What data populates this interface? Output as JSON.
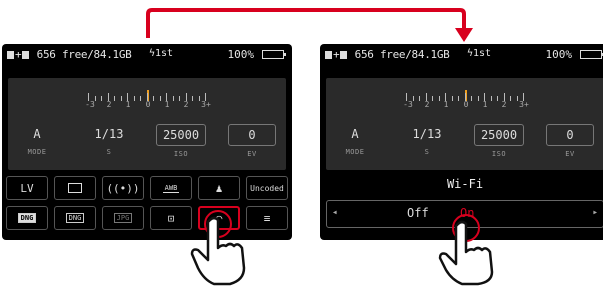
{
  "status": {
    "storage_text": "656 free/84.1GB",
    "flash_text": "ϟ1st",
    "battery_percent": "100%"
  },
  "meter": {
    "labels": [
      "-3",
      "2",
      "1",
      "0",
      "1",
      "2",
      "3+"
    ]
  },
  "exposure": {
    "mode": {
      "value": "A",
      "label": "MODE"
    },
    "shutter": {
      "value": "1/13",
      "label": "S"
    },
    "iso": {
      "value": "25000",
      "label": "ISO"
    },
    "ev": {
      "value": "0",
      "label": "EV"
    }
  },
  "left_menu": {
    "row1": [
      "LV",
      "",
      "",
      "AWB",
      "",
      "Uncoded"
    ],
    "row2": [
      "DNG",
      "DNG",
      "JPG",
      "",
      "",
      ""
    ]
  },
  "wifi": {
    "title": "Wi-Fi",
    "option_off": "Off",
    "option_on": "On"
  },
  "colors": {
    "accent": "#d8001e",
    "battery": "#22cc33",
    "meter_marker": "#f0a020"
  },
  "icons": {
    "row1": [
      "live-view-icon",
      "frame-icon",
      "metering-icon",
      "awb-icon",
      "profile-icon",
      "lens-code-icon"
    ],
    "row2": [
      "dng-format-icon",
      "dng-jpg-format-icon",
      "jpg-format-icon",
      "timer-icon",
      "wifi-icon",
      "menu-icon"
    ]
  }
}
